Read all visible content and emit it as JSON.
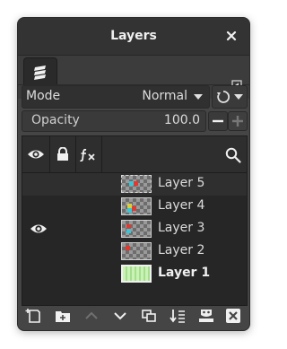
{
  "window": {
    "title": "Layers"
  },
  "mode": {
    "label": "Mode",
    "value": "Normal"
  },
  "opacity": {
    "label": "Opacity",
    "value": "100.0",
    "fraction": 1.0
  },
  "layers": [
    {
      "name": "Layer 5",
      "selected": true,
      "visible": false,
      "bold": false
    },
    {
      "name": "Layer 4",
      "selected": false,
      "visible": false,
      "bold": false
    },
    {
      "name": "Layer 3",
      "selected": false,
      "visible": true,
      "bold": false
    },
    {
      "name": "Layer 2",
      "selected": false,
      "visible": false,
      "bold": false
    },
    {
      "name": "Layer 1",
      "selected": false,
      "visible": false,
      "bold": true
    }
  ],
  "colors": {
    "accent_text": "#dcdcdc",
    "spot_red": "#e03a30",
    "spot_cyan": "#39c6d6",
    "spot_yellow": "#d8d040",
    "layer1_green": "#b6e8a0"
  }
}
